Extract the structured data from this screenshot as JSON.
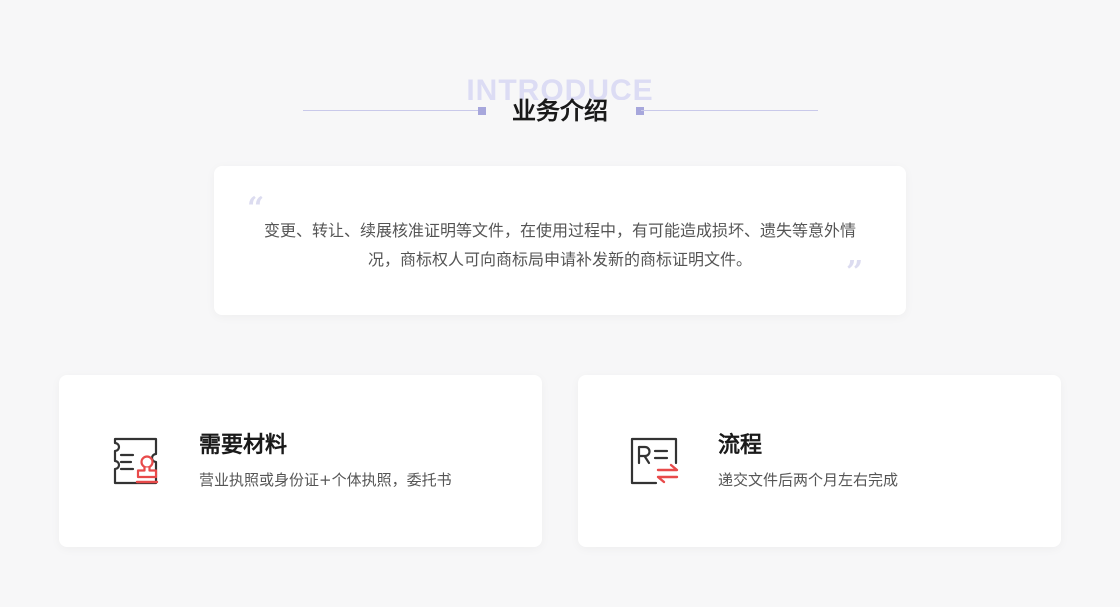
{
  "section": {
    "bg_word": "INTRODUCE",
    "title": "业务介绍"
  },
  "intro": {
    "open_quote": "“",
    "close_quote": "”",
    "text": "变更、转让、续展核准证明等文件，在使用过程中，有可能造成损坏、遗失等意外情况，商标权人可向商标局申请补发新的商标证明文件。"
  },
  "features": [
    {
      "icon": "document-stamp-icon",
      "title": "需要材料",
      "desc": "营业执照或身份证+个体执照，委托书"
    },
    {
      "icon": "registered-exchange-icon",
      "title": "流程",
      "desc": "递交文件后两个月左右完成"
    }
  ],
  "colors": {
    "accent_red": "#e84a4a",
    "icon_dark": "#333333",
    "header_decor": "#a7a7dc",
    "bg_word": "#dcdcf4"
  }
}
